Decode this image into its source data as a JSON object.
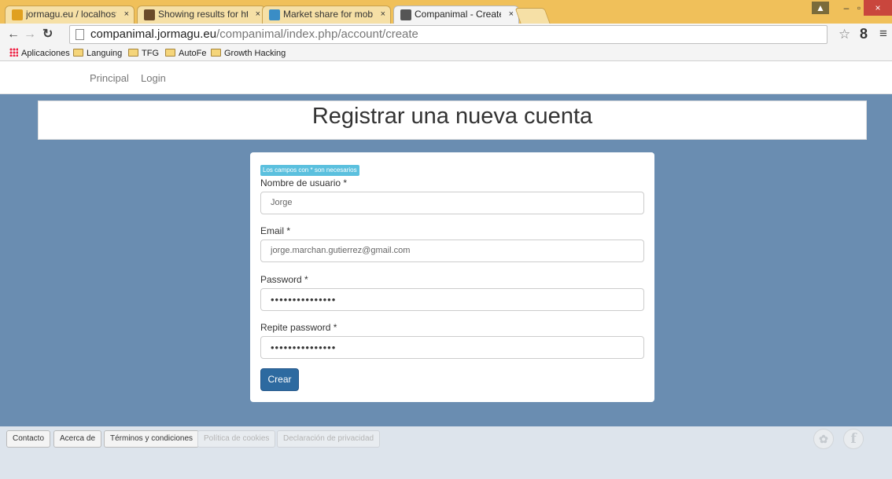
{
  "browser": {
    "tabs": [
      {
        "title": "jormagu.eu / localhost / c",
        "active": false,
        "favicon_color": "#e0a020"
      },
      {
        "title": "Showing results for http:/",
        "active": false,
        "favicon_color": "#6b4a2a"
      },
      {
        "title": "Market share for mobile, l",
        "active": false,
        "favicon_color": "#3a8dc6"
      },
      {
        "title": "Companimal - Create Acc",
        "active": true,
        "favicon_color": "#555555"
      }
    ],
    "tab_close_glyph": "×",
    "window_controls": {
      "minimize": "–",
      "maximize": "▫",
      "close": "×"
    },
    "url_host": "companimal.jormagu.eu",
    "url_path": "/companimal/index.php/account/create",
    "nav_icons": [
      "back-arrow-icon",
      "forward-arrow-icon",
      "reload-icon"
    ],
    "bookmarks": [
      {
        "label": "Aplicaciones",
        "icon": "apps-grid-icon"
      },
      {
        "label": "Languing",
        "icon": "folder-icon"
      },
      {
        "label": "TFG",
        "icon": "folder-icon"
      },
      {
        "label": "AutoFe",
        "icon": "folder-icon"
      },
      {
        "label": "Growth Hacking",
        "icon": "folder-icon"
      }
    ]
  },
  "site": {
    "nav": {
      "principal": "Principal",
      "login": "Login"
    },
    "header_title": "Registrar una nueva cuenta",
    "form": {
      "required_note": "Los campos con * son necesarios",
      "username_label": "Nombre de usuario *",
      "username_value": "Jorge",
      "email_label": "Email *",
      "email_value": "jorge.marchan.gutierrez@gmail.com",
      "password_label": "Password *",
      "password_value": "•••••••••••••••",
      "repeat_label": "Repite password *",
      "repeat_value": "•••••••••••••••",
      "submit_label": "Crear"
    },
    "footer": {
      "buttons": [
        {
          "label": "Contacto",
          "enabled": true
        },
        {
          "label": "Acerca de",
          "enabled": true
        },
        {
          "label": "Términos y condiciones",
          "enabled": true
        },
        {
          "label": "Política de cookies",
          "enabled": false
        },
        {
          "label": "Declaración de privacidad",
          "enabled": false
        }
      ],
      "social": [
        "twitter-icon",
        "facebook-icon"
      ]
    }
  },
  "colors": {
    "page_background": "#6a8db1",
    "primary_button": "#2d6aa0",
    "info_badge": "#5bc0de"
  }
}
